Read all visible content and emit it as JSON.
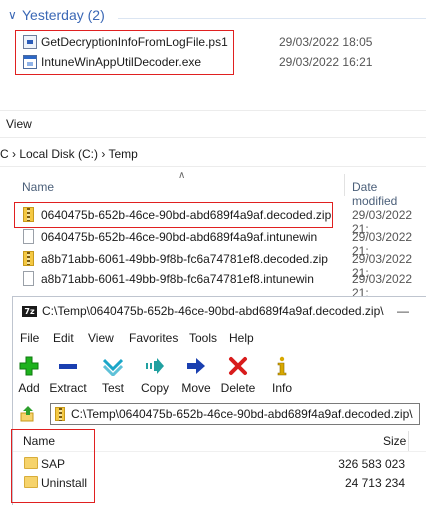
{
  "downloads": {
    "group_label": "Yesterday (2)",
    "files": [
      {
        "name": "GetDecryptionInfoFromLogFile.ps1",
        "date": "29/03/2022 18:05",
        "icon": "powershell-script-icon"
      },
      {
        "name": "IntuneWinAppUtilDecoder.exe",
        "date": "29/03/2022 16:21",
        "icon": "executable-icon"
      }
    ]
  },
  "explorer": {
    "ribbon_view": "View",
    "address": "C  ›  Local Disk (C:)  ›  Temp",
    "col_name": "Name",
    "col_date": "Date modified",
    "files": [
      {
        "name": "0640475b-652b-46ce-90bd-abd689f4a9af.decoded.zip",
        "date": "29/03/2022 21:",
        "icon": "zip-icon"
      },
      {
        "name": "0640475b-652b-46ce-90bd-abd689f4a9af.intunewin",
        "date": "29/03/2022 21:",
        "icon": "document-icon"
      },
      {
        "name": "a8b71abb-6061-49bb-9f8b-fc6a74781ef8.decoded.zip",
        "date": "29/03/2022 21:",
        "icon": "zip-icon"
      },
      {
        "name": "a8b71abb-6061-49bb-9f8b-fc6a74781ef8.intunewin",
        "date": "29/03/2022 21:",
        "icon": "document-icon"
      }
    ]
  },
  "sevenzip": {
    "logo_text": "7z",
    "title": "C:\\Temp\\0640475b-652b-46ce-90bd-abd689f4a9af.decoded.zip\\",
    "minimize_glyph": "—",
    "menu": [
      "File",
      "Edit",
      "View",
      "Favorites",
      "Tools",
      "Help"
    ],
    "toolbar": [
      {
        "label": "Add",
        "icon": "add-icon",
        "color": "#1db21d"
      },
      {
        "label": "Extract",
        "icon": "extract-icon",
        "color": "#1a3fb0"
      },
      {
        "label": "Test",
        "icon": "test-icon",
        "color": "#1aa6c8"
      },
      {
        "label": "Copy",
        "icon": "copy-icon",
        "color": "#20a0a0"
      },
      {
        "label": "Move",
        "icon": "move-icon",
        "color": "#1a3fb0"
      },
      {
        "label": "Delete",
        "icon": "delete-icon",
        "color": "#d81c1c"
      },
      {
        "label": "Info",
        "icon": "info-icon",
        "color": "#d8a800"
      }
    ],
    "path": "C:\\Temp\\0640475b-652b-46ce-90bd-abd689f4a9af.decoded.zip\\",
    "col_name": "Name",
    "col_size": "Size",
    "items": [
      {
        "name": "SAP",
        "size": "326 583 023"
      },
      {
        "name": "Uninstall",
        "size": "24 713 234"
      }
    ]
  },
  "colors": {
    "highlight_box": "#e02020",
    "group_header": "#3a67b5"
  }
}
